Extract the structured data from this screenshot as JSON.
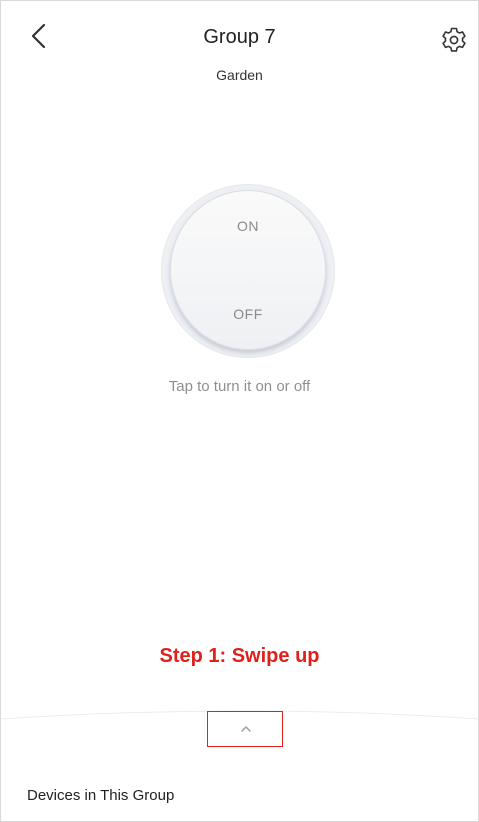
{
  "header": {
    "title": "Group 7",
    "subtitle": "Garden",
    "back_icon": "chevron-left-icon",
    "settings_icon": "gear-icon"
  },
  "toggle": {
    "on_label": "ON",
    "off_label": "OFF",
    "hint": "Tap to turn it on or off"
  },
  "annotation": {
    "text": "Step 1: Swipe up",
    "color": "#e0211b"
  },
  "bottom_sheet": {
    "handle_icon": "chevron-up-icon",
    "heading": "Devices in This Group"
  }
}
